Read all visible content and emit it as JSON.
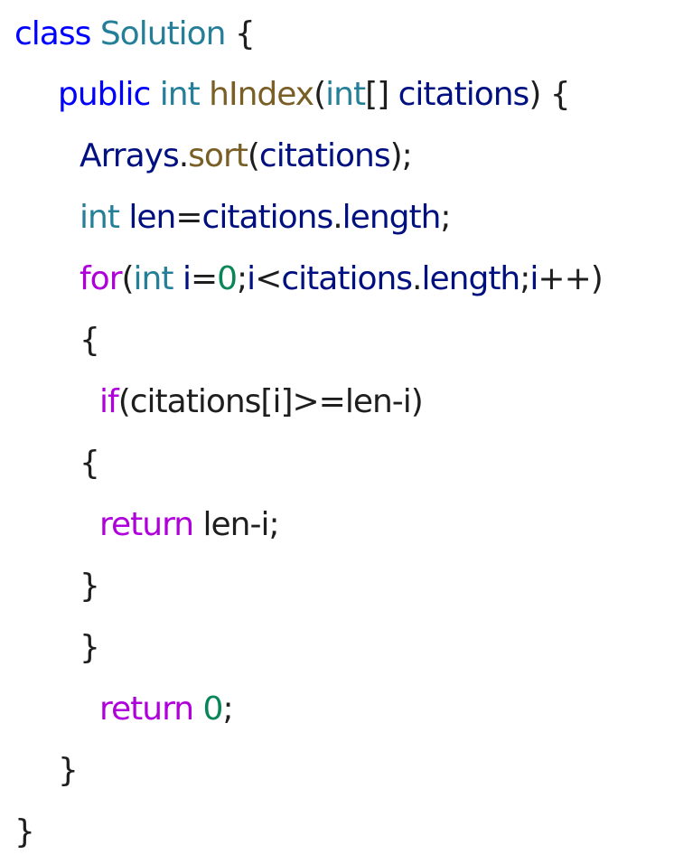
{
  "theme": {
    "keyword_blue": "#0000ff",
    "type_teal": "#267f99",
    "function_brown": "#795e26",
    "control_purple": "#af00db",
    "identifier_navy": "#001080",
    "number_green": "#098658",
    "text_default": "#1e1e1e"
  },
  "code": {
    "lines": [
      {
        "tokens": [
          {
            "t": "class",
            "k": "keyword"
          },
          {
            "t": " ",
            "k": "plain"
          },
          {
            "t": "Solution",
            "k": "type"
          },
          {
            "t": " {",
            "k": "plain"
          }
        ]
      },
      {
        "tokens": [
          {
            "t": "public",
            "k": "keyword"
          },
          {
            "t": " ",
            "k": "plain"
          },
          {
            "t": "int",
            "k": "type"
          },
          {
            "t": " ",
            "k": "plain"
          },
          {
            "t": "hIndex",
            "k": "function"
          },
          {
            "t": "(",
            "k": "plain"
          },
          {
            "t": "int",
            "k": "type"
          },
          {
            "t": "[] ",
            "k": "plain"
          },
          {
            "t": "citations",
            "k": "ident"
          },
          {
            "t": ") {",
            "k": "plain"
          }
        ]
      },
      {
        "tokens": [
          {
            "t": "Arrays",
            "k": "ident"
          },
          {
            "t": ".",
            "k": "plain"
          },
          {
            "t": "sort",
            "k": "function"
          },
          {
            "t": "(",
            "k": "plain"
          },
          {
            "t": "citations",
            "k": "ident"
          },
          {
            "t": ");",
            "k": "plain"
          }
        ]
      },
      {
        "tokens": [
          {
            "t": "int",
            "k": "type"
          },
          {
            "t": " ",
            "k": "plain"
          },
          {
            "t": "len",
            "k": "ident"
          },
          {
            "t": "=",
            "k": "plain"
          },
          {
            "t": "citations",
            "k": "ident"
          },
          {
            "t": ".",
            "k": "plain"
          },
          {
            "t": "length",
            "k": "ident"
          },
          {
            "t": ";",
            "k": "plain"
          }
        ]
      },
      {
        "tokens": [
          {
            "t": "for",
            "k": "control"
          },
          {
            "t": "(",
            "k": "plain"
          },
          {
            "t": "int",
            "k": "type"
          },
          {
            "t": " ",
            "k": "plain"
          },
          {
            "t": "i",
            "k": "ident"
          },
          {
            "t": "=",
            "k": "plain"
          },
          {
            "t": "0",
            "k": "number"
          },
          {
            "t": ";",
            "k": "plain"
          },
          {
            "t": "i",
            "k": "ident"
          },
          {
            "t": "<",
            "k": "plain"
          },
          {
            "t": "citations",
            "k": "ident"
          },
          {
            "t": ".",
            "k": "plain"
          },
          {
            "t": "length",
            "k": "ident"
          },
          {
            "t": ";",
            "k": "plain"
          },
          {
            "t": "i",
            "k": "ident"
          },
          {
            "t": "++)",
            "k": "plain"
          }
        ]
      },
      {
        "tokens": [
          {
            "t": "{",
            "k": "plain"
          }
        ]
      },
      {
        "tokens": [
          {
            "t": "if",
            "k": "control"
          },
          {
            "t": "(citations[i]>=len-i)",
            "k": "plain"
          }
        ]
      },
      {
        "tokens": [
          {
            "t": "{",
            "k": "plain"
          }
        ]
      },
      {
        "tokens": [
          {
            "t": "return",
            "k": "control"
          },
          {
            "t": " len-i;",
            "k": "plain"
          }
        ]
      },
      {
        "tokens": [
          {
            "t": "}",
            "k": "plain"
          }
        ]
      },
      {
        "tokens": [
          {
            "t": "}",
            "k": "plain"
          }
        ]
      },
      {
        "tokens": [
          {
            "t": "return",
            "k": "control"
          },
          {
            "t": " ",
            "k": "plain"
          },
          {
            "t": "0",
            "k": "number"
          },
          {
            "t": ";",
            "k": "plain"
          }
        ]
      },
      {
        "tokens": [
          {
            "t": "}",
            "k": "plain"
          }
        ]
      },
      {
        "tokens": [
          {
            "t": "}",
            "k": "plain"
          }
        ]
      }
    ]
  }
}
